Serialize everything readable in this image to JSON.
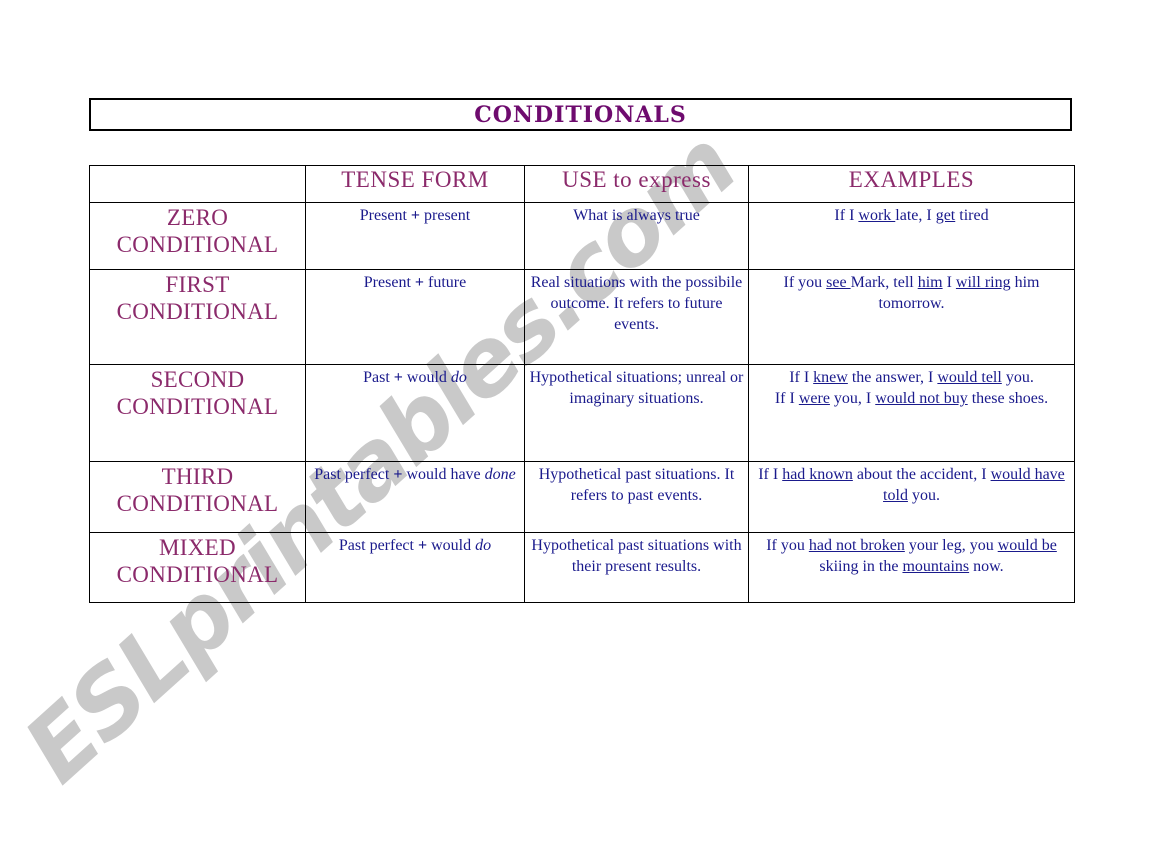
{
  "document": {
    "title": "CONDITIONALS",
    "watermark": "ESLprintables.com",
    "title_color": "#6e0b6e",
    "header_color": "#8b2a6b",
    "body_color": "#1a1a8c",
    "border_color": "#000000",
    "watermark_color": "#c9c9c9"
  },
  "table": {
    "headers": [
      "",
      "TENSE FORM",
      "USE to express",
      "EXAMPLES"
    ],
    "rows": [
      {
        "type_line1": "ZERO",
        "type_line2": "CONDITIONAL",
        "tense_form": "Present + present",
        "tense_form_html": "Present <b>+</b> present",
        "use": "What is always true",
        "use_html": "What is always true",
        "examples": "If I work late, I get tired",
        "examples_html": "If I <u>work </u>late, I <u>get</u> tired"
      },
      {
        "type_line1": "FIRST",
        "type_line2": "CONDITIONAL",
        "tense_form": "Present + future",
        "tense_form_html": "Present <b>+</b> future",
        "use": "Real situations with the possibile outcome. It refers to future events.",
        "use_html": "Real situations with the possibile outcome. It refers to future events.",
        "examples": "If you see Mark, tell him I will ring him tomorrow.",
        "examples_html": "If you <u>see </u>Mark, tell <u>him</u> I <u>will ring</u> him tomorrow."
      },
      {
        "type_line1": "SECOND",
        "type_line2": "CONDITIONAL",
        "tense_form": "Past + would do",
        "tense_form_html": "Past <b>+</b> would <i>do</i>",
        "use": "Hypothetical situations; unreal or imaginary situations.",
        "use_html": "Hypothetical situations; unreal or imaginary situations.",
        "examples": "If I knew the answer, I would tell you. If I were you, I would not buy these shoes.",
        "examples_html": "If I <u>knew</u> the answer, I <u>would tell</u> you.<br>If I <u>were</u> you, I <u>would not buy</u> these shoes."
      },
      {
        "type_line1": "THIRD",
        "type_line2": "CONDITIONAL",
        "tense_form": "Past perfect + would have done",
        "tense_form_html": "Past perfect <b>+</b> would have <i>done</i>",
        "use": "Hypothetical past situations. It refers to past events.",
        "use_html": "Hypothetical past situations. It refers to past events.",
        "examples": "If I had known about the accident, I would have told you.",
        "examples_html": "If I <u>had known</u> about the accident, I <u>would have told</u> you."
      },
      {
        "type_line1": "MIXED",
        "type_line2": "CONDITIONAL",
        "tense_form": "Past perfect + would do",
        "tense_form_html": "Past perfect <b>+</b> would <i>do</i>",
        "use": "Hypothetical past situations with their present results.",
        "use_html": "Hypothetical past situations with their present results.",
        "examples": "If you had not broken your leg, you would be skiing in the mountains now.",
        "examples_html": "If you <u>had not broken</u> your leg, you <u>would be</u> skiing in the <u>mountains</u> now."
      }
    ]
  }
}
